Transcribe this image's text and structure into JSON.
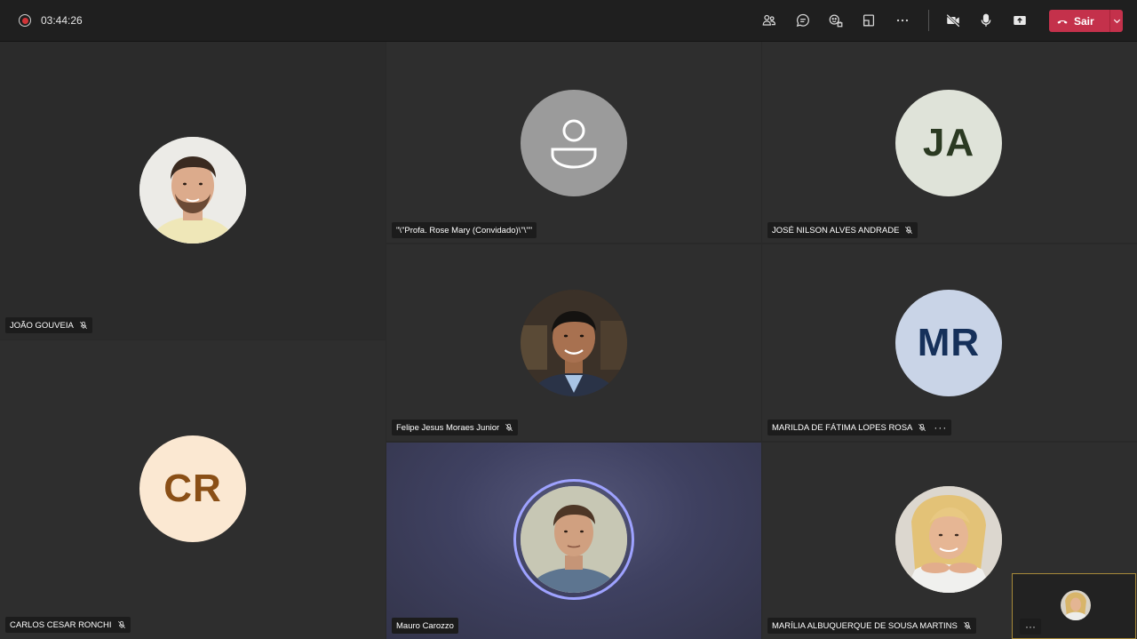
{
  "meeting": {
    "timer": "03:44:26",
    "leave_label": "Sair"
  },
  "toolbar_icons": [
    "people-icon",
    "chat-icon",
    "reactions-icon",
    "layout-icon",
    "more-icon",
    "camera-off-icon",
    "microphone-icon",
    "share-screen-icon"
  ],
  "colors": {
    "leave": "#c4314b",
    "recording": "#d13438",
    "active_ring": "#9ea2ff"
  },
  "participants": [
    {
      "name": "JOÃO GOUVEIA",
      "muted": true,
      "avatar": "photo"
    },
    {
      "name": "\"\\\"Profa. Rose Mary (Convidado)\\\"\\\"\"",
      "muted": false,
      "avatar": "generic"
    },
    {
      "name": "JOSÉ NILSON ALVES ANDRADE",
      "muted": true,
      "initials": "JA",
      "avatar_color": "#dfe3d9",
      "initials_color": "#2b3a22"
    },
    {
      "name": "Felipe Jesus Moraes Junior",
      "muted": true,
      "avatar": "photo"
    },
    {
      "name": "MARILDA DE FÁTIMA LOPES ROSA",
      "muted": true,
      "more": "···",
      "initials": "MR",
      "avatar_color": "#c9d4e7",
      "initials_color": "#15305a"
    },
    {
      "name": "CARLOS CESAR RONCHI",
      "muted": true,
      "initials": "CR",
      "avatar_color": "#fbe8d2",
      "initials_color": "#8a4f16"
    },
    {
      "name": "Mauro Carozzo",
      "muted": false,
      "avatar": "photo",
      "speaking": true
    },
    {
      "name": "MARÍLIA ALBUQUERQUE DE SOUSA MARTINS",
      "muted": true,
      "avatar": "photo"
    }
  ],
  "self_view": {
    "more": "···"
  }
}
